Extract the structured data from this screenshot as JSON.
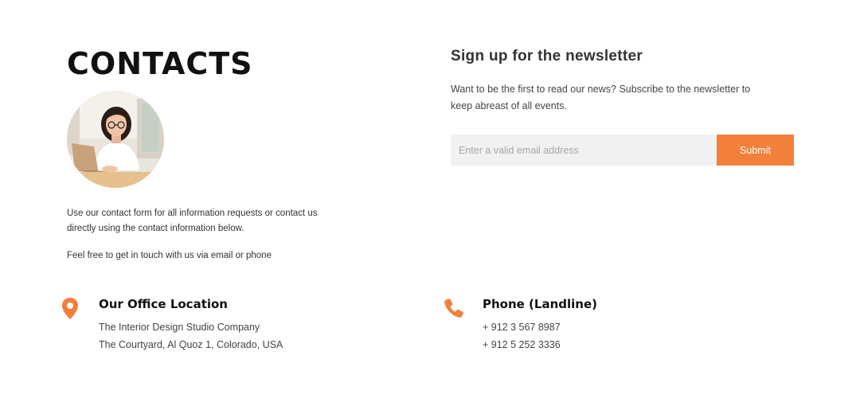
{
  "contacts": {
    "title": "CONTACTS",
    "intro": "Use our contact form for all information requests or contact us directly using the contact information below.",
    "note": "Feel free to get in touch with us via email or phone"
  },
  "newsletter": {
    "title": "Sign up for the newsletter",
    "description": "Want to be the first to read our news? Subscribe to the newsletter to keep abreast of all events.",
    "email_placeholder": "Enter a valid email address",
    "submit_label": "Submit"
  },
  "office": {
    "icon": "location-pin-icon",
    "heading": "Our Office Location",
    "lines": [
      "The Interior Design Studio Company",
      "The Courtyard, Al Quoz 1, Colorado,  USA"
    ]
  },
  "phone": {
    "icon": "phone-icon",
    "heading": "Phone (Landline)",
    "lines": [
      "+ 912 3 567 8987",
      "+ 912 5 252 3336"
    ]
  },
  "colors": {
    "accent": "#f2803a",
    "input_bg": "#f1f1f1",
    "text": "#222222"
  }
}
